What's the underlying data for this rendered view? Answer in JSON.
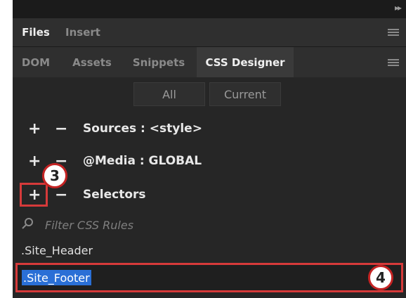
{
  "panel": {
    "tabs_top": [
      {
        "label": "Files",
        "active": true
      },
      {
        "label": "Insert",
        "active": false
      }
    ],
    "tabs_second": [
      {
        "label": "DOM",
        "active": false
      },
      {
        "label": "Assets",
        "active": false
      },
      {
        "label": "Snippets",
        "active": false
      },
      {
        "label": "CSS Designer",
        "active": true
      }
    ],
    "toggle": {
      "all": "All",
      "current": "Current",
      "selected": "All"
    }
  },
  "sections": {
    "sources": {
      "plus": "+",
      "minus": "−",
      "label": "Sources : <style>"
    },
    "media": {
      "plus": "+",
      "minus": "−",
      "label": "@Media : GLOBAL"
    },
    "selectors": {
      "plus": "+",
      "minus": "−",
      "label": "Selectors"
    }
  },
  "filter": {
    "placeholder": "Filter CSS Rules"
  },
  "selectors_list": [
    ".Site_Header"
  ],
  "editing_selector": ".Site_Footer",
  "markers": {
    "three": "3",
    "four": "4"
  },
  "colors": {
    "accent_red": "#d63a3a",
    "selection_blue": "#2a6fd6"
  }
}
